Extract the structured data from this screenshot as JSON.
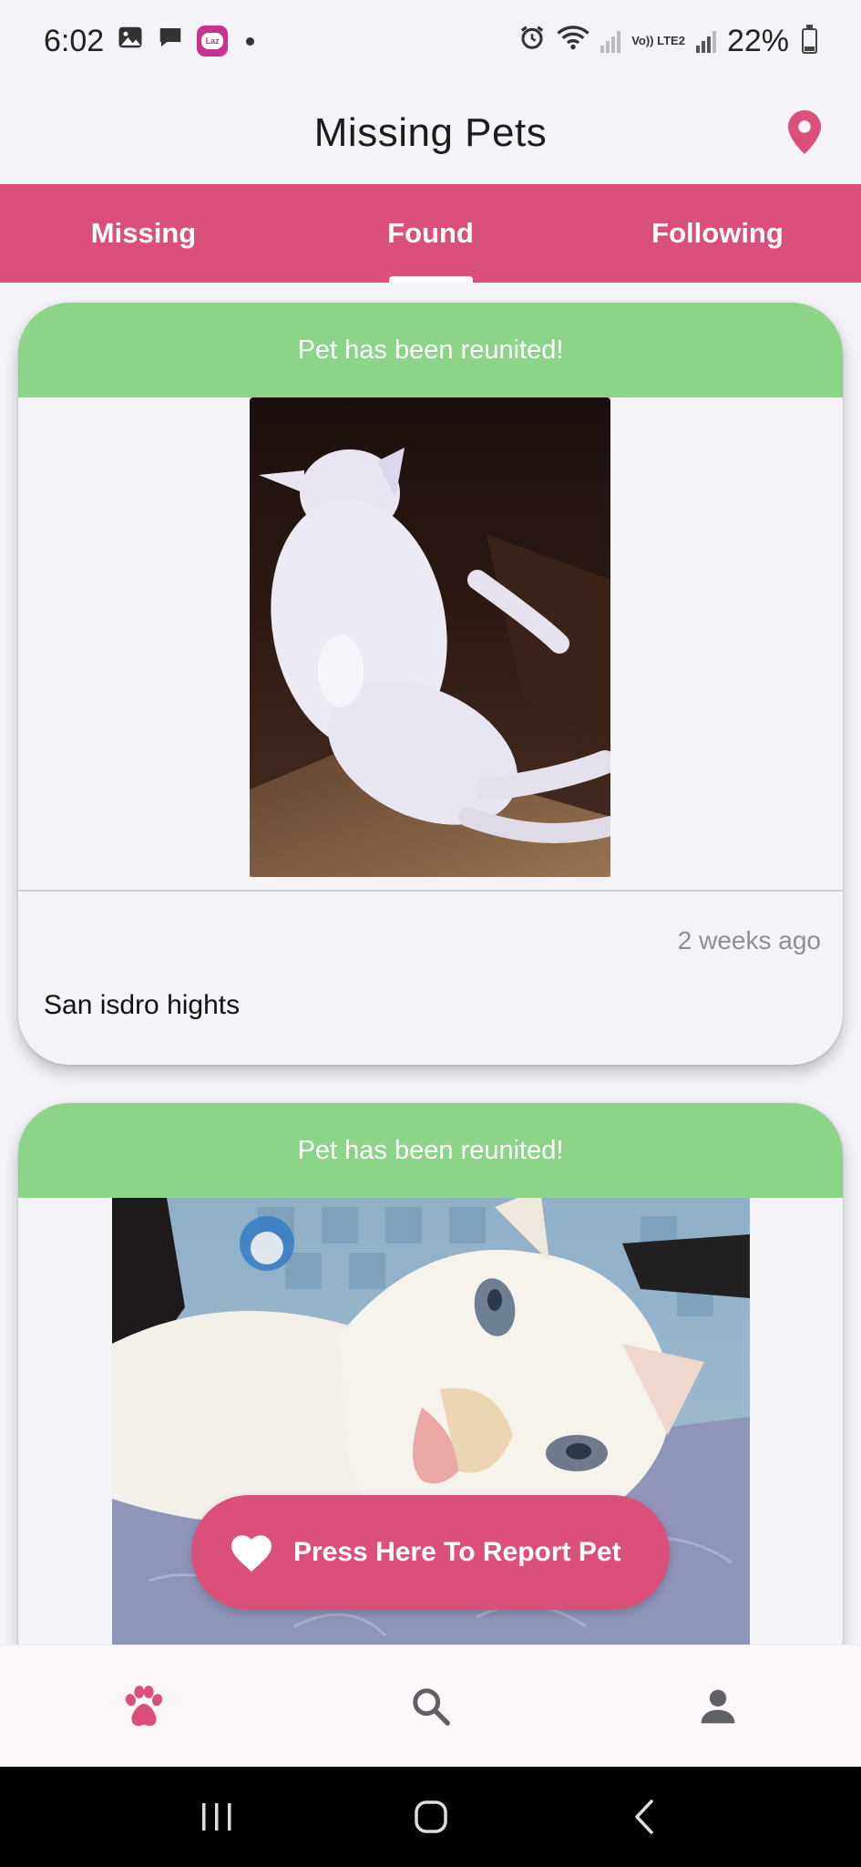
{
  "status_bar": {
    "time": "6:02",
    "battery": "22%",
    "network_label": "Vo)) LTE2"
  },
  "app_bar": {
    "title": "Missing Pets",
    "location_icon": "location-pin-icon"
  },
  "tabs": [
    {
      "label": "Missing",
      "active": false
    },
    {
      "label": "Found",
      "active": true
    },
    {
      "label": "Following",
      "active": false
    }
  ],
  "cards": [
    {
      "banner": "Pet has been reunited!",
      "time_ago": "2 weeks ago",
      "location": "San isdro hights"
    },
    {
      "banner": "Pet has been reunited!"
    }
  ],
  "report_button": {
    "label": "Press Here To Report Pet",
    "icon": "heart-icon"
  },
  "bottom_nav": [
    {
      "icon": "paw-icon",
      "active": true
    },
    {
      "icon": "search-icon",
      "active": false
    },
    {
      "icon": "person-icon",
      "active": false
    }
  ],
  "colors": {
    "accent": "#db4f7b",
    "banner_green": "#8dd48a",
    "background": "#f4f3f8"
  }
}
